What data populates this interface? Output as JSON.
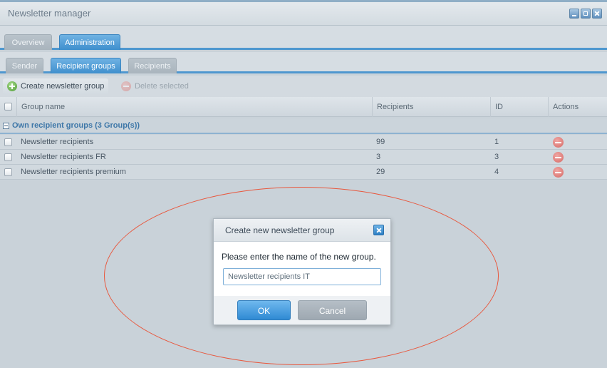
{
  "window": {
    "title": "Newsletter manager"
  },
  "main_tabs": [
    {
      "label": "Overview",
      "active": false
    },
    {
      "label": "Administration",
      "active": true
    }
  ],
  "sub_tabs": [
    {
      "label": "Sender",
      "active": false
    },
    {
      "label": "Recipient groups",
      "active": true
    },
    {
      "label": "Recipients",
      "active": false
    }
  ],
  "toolbar": {
    "create_label": "Create newsletter group",
    "delete_label": "Delete selected"
  },
  "grid": {
    "columns": [
      "Group name",
      "Recipients",
      "ID",
      "Actions"
    ],
    "group_label": "Own recipient groups (3 Group(s))",
    "rows": [
      {
        "name": "Newsletter recipients",
        "recipients": "99",
        "id": "1"
      },
      {
        "name": "Newsletter recipients FR",
        "recipients": "3",
        "id": "3"
      },
      {
        "name": "Newsletter recipients premium",
        "recipients": "29",
        "id": "4"
      }
    ]
  },
  "dialog": {
    "title": "Create new newsletter group",
    "message": "Please enter the name of the new group.",
    "input_value": "Newsletter recipients IT",
    "ok_label": "OK",
    "cancel_label": "Cancel"
  },
  "colors": {
    "accent": "#4e97cf",
    "highlight_ellipse": "#e8583e",
    "group_label": "#3e77a8"
  }
}
